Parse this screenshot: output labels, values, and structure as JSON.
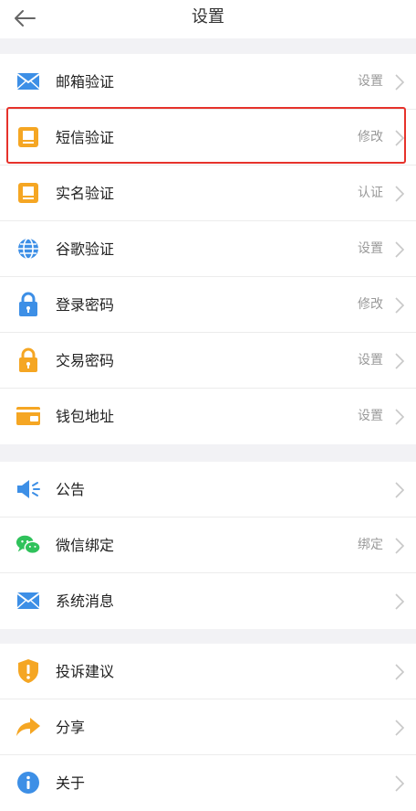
{
  "header": {
    "title": "设置"
  },
  "group1": [
    {
      "label": "邮箱验证",
      "value": "设置",
      "icon": "mail-icon"
    },
    {
      "label": "短信验证",
      "value": "修改",
      "icon": "phone-icon"
    },
    {
      "label": "实名验证",
      "value": "认证",
      "icon": "id-card-icon"
    },
    {
      "label": "谷歌验证",
      "value": "设置",
      "icon": "globe-icon"
    },
    {
      "label": "登录密码",
      "value": "修改",
      "icon": "lock-icon"
    },
    {
      "label": "交易密码",
      "value": "设置",
      "icon": "lock-icon"
    },
    {
      "label": "钱包地址",
      "value": "设置",
      "icon": "wallet-icon"
    }
  ],
  "group2": [
    {
      "label": "公告",
      "value": "",
      "icon": "megaphone-icon"
    },
    {
      "label": "微信绑定",
      "value": "绑定",
      "icon": "wechat-icon"
    },
    {
      "label": "系统消息",
      "value": "",
      "icon": "mail-icon"
    }
  ],
  "group3": [
    {
      "label": "投诉建议",
      "value": "",
      "icon": "shield-alert-icon"
    },
    {
      "label": "分享",
      "value": "",
      "icon": "share-icon"
    },
    {
      "label": "关于",
      "value": "",
      "icon": "info-icon"
    }
  ],
  "colors": {
    "blue": "#3d8fe6",
    "orange": "#f5a623",
    "green": "#2fc25b",
    "highlight": "#e6322b"
  }
}
